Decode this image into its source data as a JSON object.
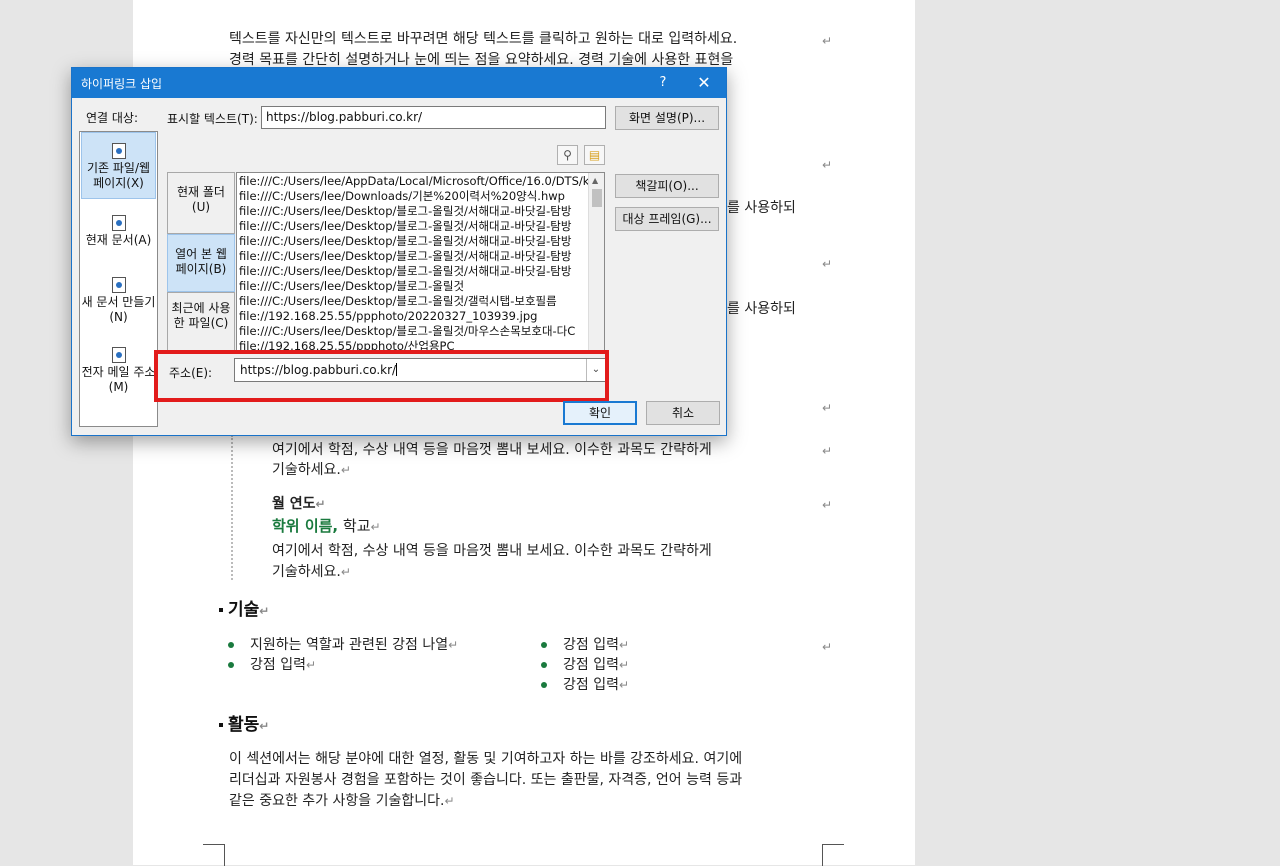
{
  "document": {
    "intro_line1": "텍스트를 자신만의 텍스트로 바꾸려면 해당 텍스트를 클릭하고 원하는 대로 입력하세요.",
    "intro_line2": "경력 목표를 간단히 설명하거나 눈에 띄는 점을 요약하세요. 경력 기술에 사용한 표현을",
    "fragment1": "를 사용하되",
    "fragment2": "를 사용하되",
    "edu_desc1_line1": "여기에서 학점, 수상 내역 등을 마음껏 뽐내 보세요. 이수한 과목도 간략하게",
    "edu_desc1_line2": "기술하세요.",
    "edu_year": "월 연도",
    "degree_name": "학위 이름,",
    "school": " 학교",
    "edu_desc2_line1": "여기에서 학점, 수상 내역 등을 마음껏 뽐내 보세요. 이수한 과목도 간략하게",
    "edu_desc2_line2": "기술하세요.",
    "skills_heading": "기술",
    "skills_left": [
      "지원하는 역할과 관련된 강점 나열",
      "강점 입력"
    ],
    "skills_right": [
      "강점 입력",
      "강점 입력",
      "강점 입력"
    ],
    "activities_heading": "활동",
    "activities_line1": "이 섹션에서는 해당 분야에 대한 열정, 활동 및 기여하고자 하는 바를 강조하세요. 여기에",
    "activities_line2": "리더십과 자원봉사 경험을 포함하는 것이 좋습니다. 또는 출판물, 자격증, 언어 능력 등과",
    "activities_line3": "같은 중요한 추가 사항을 기술합니다.",
    "para_mark": "↵"
  },
  "dialog": {
    "title": "하이퍼링크 삽입",
    "help": "?",
    "close": "✕",
    "link_to_label": "연결 대상:",
    "link_to": [
      {
        "label": "기존 파일/웹 페이지(X)",
        "icon": "existing-file-web-page-icon"
      },
      {
        "label": "현재 문서(A)",
        "icon": "current-document-icon"
      },
      {
        "label": "새 문서 만들기(N)",
        "icon": "new-document-icon"
      },
      {
        "label": "전자 메일 주소(M)",
        "icon": "email-address-icon"
      }
    ],
    "display_text_label": "표시할 텍스트(T):",
    "display_text_value": "https://blog.pabburi.co.kr/",
    "screentip_button": "화면 설명(P)...",
    "bookmark_button": "책갈피(O)...",
    "target_frame_button": "대상 프레임(G)...",
    "lookin_tabs": [
      "현재 폴더(U)",
      "열어 본 웹 페이지(B)",
      "최근에 사용한 파일(C)"
    ],
    "files": [
      "file:///C:/Users/lee/AppData/Local/Microsoft/Office/16.0/DTS/ko-",
      "file:///C:/Users/lee/Downloads/기본%20이력서%20양식.hwp",
      "file:///C:/Users/lee/Desktop/블로그-올릴것/서해대교-바닷길-탐방",
      "file:///C:/Users/lee/Desktop/블로그-올릴것/서해대교-바닷길-탐방",
      "file:///C:/Users/lee/Desktop/블로그-올릴것/서해대교-바닷길-탐방",
      "file:///C:/Users/lee/Desktop/블로그-올릴것/서해대교-바닷길-탐방",
      "file:///C:/Users/lee/Desktop/블로그-올릴것/서해대교-바닷길-탐방",
      "file:///C:/Users/lee/Desktop/블로그-올릴것",
      "file:///C:/Users/lee/Desktop/블로그-올릴것/갤럭시탭-보호필름",
      "file://192.168.25.55/ppphoto/20220327_103939.jpg",
      "file:///C:/Users/lee/Desktop/블로그-올릴것/마우스손목보호대-다C",
      "file://192.168.25.55/ppphoto/산업용PC"
    ],
    "address_label": "주소(E):",
    "address_value": "https://blog.pabburi.co.kr/",
    "ok_button": "확인",
    "cancel_button": "취소",
    "highlight_color": "#e21b1b",
    "titlebar_color": "#1979d2"
  }
}
